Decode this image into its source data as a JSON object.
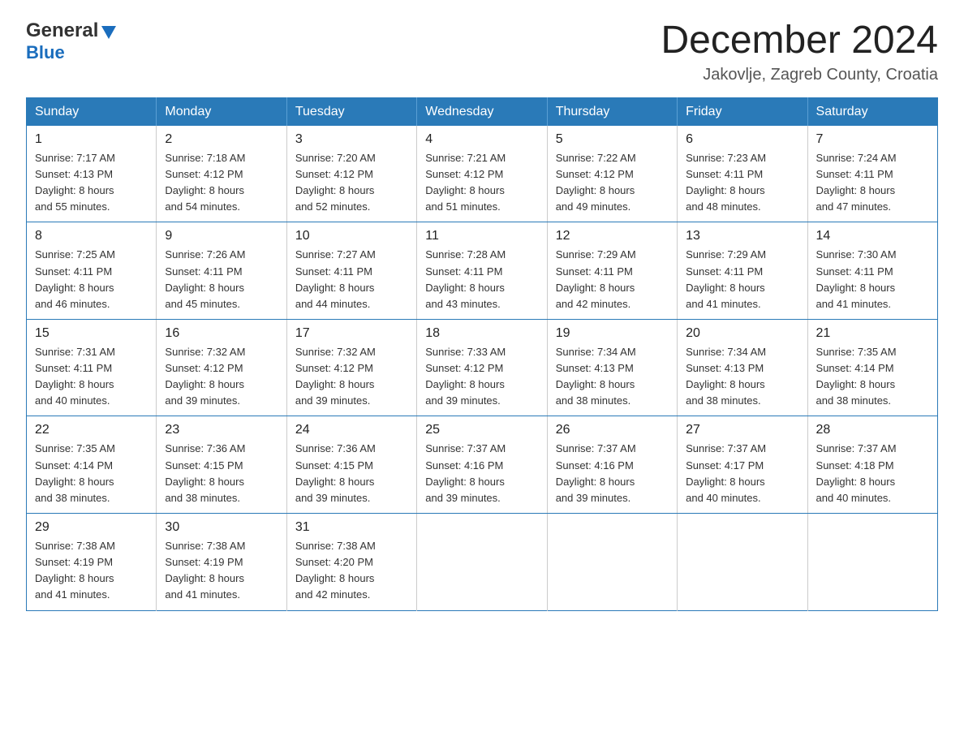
{
  "header": {
    "logo_line1": "General",
    "logo_line2": "Blue",
    "title": "December 2024",
    "subtitle": "Jakovlje, Zagreb County, Croatia"
  },
  "days_of_week": [
    "Sunday",
    "Monday",
    "Tuesday",
    "Wednesday",
    "Thursday",
    "Friday",
    "Saturday"
  ],
  "weeks": [
    [
      {
        "date": "1",
        "sunrise": "7:17 AM",
        "sunset": "4:13 PM",
        "daylight": "8 hours and 55 minutes."
      },
      {
        "date": "2",
        "sunrise": "7:18 AM",
        "sunset": "4:12 PM",
        "daylight": "8 hours and 54 minutes."
      },
      {
        "date": "3",
        "sunrise": "7:20 AM",
        "sunset": "4:12 PM",
        "daylight": "8 hours and 52 minutes."
      },
      {
        "date": "4",
        "sunrise": "7:21 AM",
        "sunset": "4:12 PM",
        "daylight": "8 hours and 51 minutes."
      },
      {
        "date": "5",
        "sunrise": "7:22 AM",
        "sunset": "4:12 PM",
        "daylight": "8 hours and 49 minutes."
      },
      {
        "date": "6",
        "sunrise": "7:23 AM",
        "sunset": "4:11 PM",
        "daylight": "8 hours and 48 minutes."
      },
      {
        "date": "7",
        "sunrise": "7:24 AM",
        "sunset": "4:11 PM",
        "daylight": "8 hours and 47 minutes."
      }
    ],
    [
      {
        "date": "8",
        "sunrise": "7:25 AM",
        "sunset": "4:11 PM",
        "daylight": "8 hours and 46 minutes."
      },
      {
        "date": "9",
        "sunrise": "7:26 AM",
        "sunset": "4:11 PM",
        "daylight": "8 hours and 45 minutes."
      },
      {
        "date": "10",
        "sunrise": "7:27 AM",
        "sunset": "4:11 PM",
        "daylight": "8 hours and 44 minutes."
      },
      {
        "date": "11",
        "sunrise": "7:28 AM",
        "sunset": "4:11 PM",
        "daylight": "8 hours and 43 minutes."
      },
      {
        "date": "12",
        "sunrise": "7:29 AM",
        "sunset": "4:11 PM",
        "daylight": "8 hours and 42 minutes."
      },
      {
        "date": "13",
        "sunrise": "7:29 AM",
        "sunset": "4:11 PM",
        "daylight": "8 hours and 41 minutes."
      },
      {
        "date": "14",
        "sunrise": "7:30 AM",
        "sunset": "4:11 PM",
        "daylight": "8 hours and 41 minutes."
      }
    ],
    [
      {
        "date": "15",
        "sunrise": "7:31 AM",
        "sunset": "4:11 PM",
        "daylight": "8 hours and 40 minutes."
      },
      {
        "date": "16",
        "sunrise": "7:32 AM",
        "sunset": "4:12 PM",
        "daylight": "8 hours and 39 minutes."
      },
      {
        "date": "17",
        "sunrise": "7:32 AM",
        "sunset": "4:12 PM",
        "daylight": "8 hours and 39 minutes."
      },
      {
        "date": "18",
        "sunrise": "7:33 AM",
        "sunset": "4:12 PM",
        "daylight": "8 hours and 39 minutes."
      },
      {
        "date": "19",
        "sunrise": "7:34 AM",
        "sunset": "4:13 PM",
        "daylight": "8 hours and 38 minutes."
      },
      {
        "date": "20",
        "sunrise": "7:34 AM",
        "sunset": "4:13 PM",
        "daylight": "8 hours and 38 minutes."
      },
      {
        "date": "21",
        "sunrise": "7:35 AM",
        "sunset": "4:14 PM",
        "daylight": "8 hours and 38 minutes."
      }
    ],
    [
      {
        "date": "22",
        "sunrise": "7:35 AM",
        "sunset": "4:14 PM",
        "daylight": "8 hours and 38 minutes."
      },
      {
        "date": "23",
        "sunrise": "7:36 AM",
        "sunset": "4:15 PM",
        "daylight": "8 hours and 38 minutes."
      },
      {
        "date": "24",
        "sunrise": "7:36 AM",
        "sunset": "4:15 PM",
        "daylight": "8 hours and 39 minutes."
      },
      {
        "date": "25",
        "sunrise": "7:37 AM",
        "sunset": "4:16 PM",
        "daylight": "8 hours and 39 minutes."
      },
      {
        "date": "26",
        "sunrise": "7:37 AM",
        "sunset": "4:16 PM",
        "daylight": "8 hours and 39 minutes."
      },
      {
        "date": "27",
        "sunrise": "7:37 AM",
        "sunset": "4:17 PM",
        "daylight": "8 hours and 40 minutes."
      },
      {
        "date": "28",
        "sunrise": "7:37 AM",
        "sunset": "4:18 PM",
        "daylight": "8 hours and 40 minutes."
      }
    ],
    [
      {
        "date": "29",
        "sunrise": "7:38 AM",
        "sunset": "4:19 PM",
        "daylight": "8 hours and 41 minutes."
      },
      {
        "date": "30",
        "sunrise": "7:38 AM",
        "sunset": "4:19 PM",
        "daylight": "8 hours and 41 minutes."
      },
      {
        "date": "31",
        "sunrise": "7:38 AM",
        "sunset": "4:20 PM",
        "daylight": "8 hours and 42 minutes."
      },
      null,
      null,
      null,
      null
    ]
  ],
  "labels": {
    "sunrise": "Sunrise:",
    "sunset": "Sunset:",
    "daylight": "Daylight:"
  }
}
